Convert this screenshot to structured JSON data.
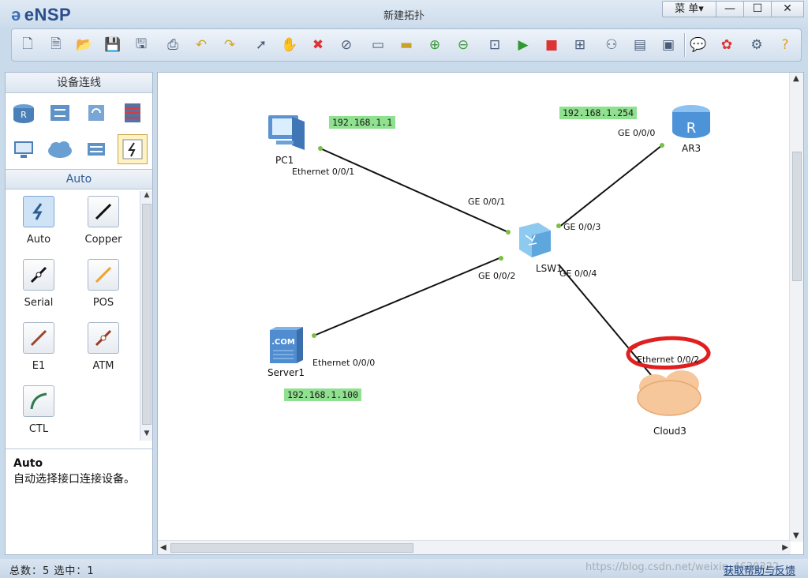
{
  "app": {
    "name": "eNSP",
    "window_title": "新建拓扑",
    "menu_label": "菜 单▾"
  },
  "window_controls": {
    "minimize": "—",
    "maximize": "☐",
    "close": "✕"
  },
  "toolbar": {
    "icons": [
      "new-topology-icon",
      "new-from-template-icon",
      "open-icon",
      "save-icon",
      "save-as-icon",
      "print-icon",
      "undo-icon",
      "redo-icon",
      "select-icon",
      "hand-pan-icon",
      "delete-icon",
      "delete-link-icon",
      "text-note-icon",
      "rectangle-icon",
      "zoom-in-icon",
      "zoom-out-icon",
      "fit-view-icon",
      "start-device-icon",
      "stop-device-icon",
      "capture-icon",
      "topology-icon",
      "interface-list-icon",
      "command-line-icon",
      "chat-icon",
      "huawei-icon",
      "settings-icon",
      "help-icon"
    ]
  },
  "left_panel": {
    "header": "设备连线",
    "device_categories": [
      "router-icon",
      "switch-icon",
      "wireless-icon",
      "firewall-icon",
      "pc-icon",
      "cloud-icon",
      "other-devices-icon",
      "links-icon"
    ],
    "subheader": "Auto",
    "cables": [
      {
        "label": "Auto",
        "icon": "auto-link-icon",
        "color": "#2d5c91"
      },
      {
        "label": "Copper",
        "icon": "copper-link-icon",
        "color": "#111111"
      },
      {
        "label": "Serial",
        "icon": "serial-link-icon",
        "color": "#111111"
      },
      {
        "label": "POS",
        "icon": "pos-link-icon",
        "color": "#f0a030"
      },
      {
        "label": "E1",
        "icon": "e1-link-icon",
        "color": "#a0442a"
      },
      {
        "label": "ATM",
        "icon": "atm-link-icon",
        "color": "#9e3a1f"
      },
      {
        "label": "CTL",
        "icon": "ctl-link-icon",
        "color": "#2f7a4a"
      }
    ],
    "description": {
      "title": "Auto",
      "text": "自动选择接口连接设备。"
    }
  },
  "topology": {
    "devices": {
      "pc1": "PC1",
      "ar3": "AR3",
      "lsw1": "LSW1",
      "server1": "Server1",
      "cloud3": "Cloud3"
    },
    "ips": {
      "pc1": "192.168.1.1",
      "ar3": "192.168.1.254",
      "server1": "192.168.1.100"
    },
    "ports": {
      "pc1": "Ethernet 0/0/1",
      "lsw1_to_pc1": "GE 0/0/1",
      "ar3": "GE 0/0/0",
      "lsw1_to_ar3": "GE 0/0/3",
      "lsw1_to_server1": "GE 0/0/2",
      "lsw1_to_cloud3": "GE 0/0/4",
      "server1": "Ethernet 0/0/0",
      "cloud3": "Ethernet 0/0/2"
    },
    "highlight_color": "#e02020"
  },
  "status": {
    "left": "总数：5 选中：1",
    "help_link": "获取帮助与反馈",
    "watermark": "https://blog.csdn.net/weixin_4630322"
  }
}
